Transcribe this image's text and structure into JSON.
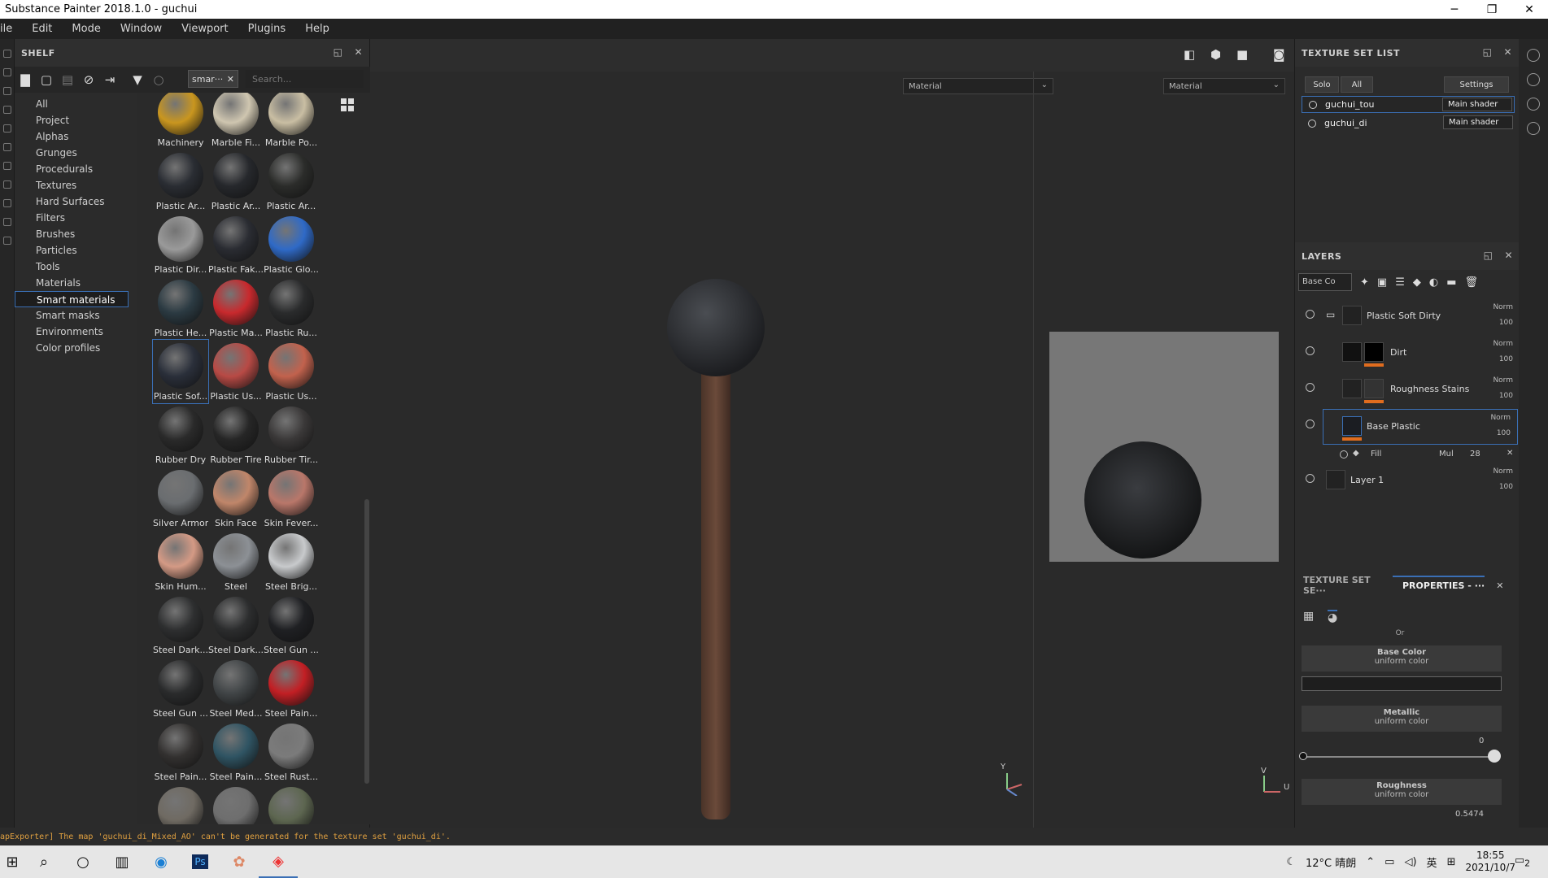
{
  "window": {
    "title": "Substance Painter 2018.1.0 - guchui",
    "min": "─",
    "max": "❐",
    "close": "✕"
  },
  "menu": [
    "ile",
    "Edit",
    "Mode",
    "Window",
    "Viewport",
    "Plugins",
    "Help"
  ],
  "shelf": {
    "title": "SHELF",
    "filter_chip": "smar···",
    "search_placeholder": "Search...",
    "categories": [
      "All",
      "Project",
      "Alphas",
      "Grunges",
      "Procedurals",
      "Textures",
      "Hard Surfaces",
      "Filters",
      "Brushes",
      "Particles",
      "Tools",
      "Materials",
      "Smart materials",
      "Smart masks",
      "Environments",
      "Color profiles"
    ],
    "selected_category": "Smart materials",
    "materials": [
      {
        "label": "Machinery",
        "color": "#c9961f"
      },
      {
        "label": "Marble Fi...",
        "color": "#cfc6b0"
      },
      {
        "label": "Marble Po...",
        "color": "#c9bea3"
      },
      {
        "label": "Plastic Ar...",
        "color": "#2a2d33"
      },
      {
        "label": "Plastic Ar...",
        "color": "#26282c"
      },
      {
        "label": "Plastic Ar...",
        "color": "#2b2c2a"
      },
      {
        "label": "Plastic Dir...",
        "color": "#9a9a9a"
      },
      {
        "label": "Plastic Fak...",
        "color": "#2a2c32"
      },
      {
        "label": "Plastic Glo...",
        "color": "#2f6ac7"
      },
      {
        "label": "Plastic He...",
        "color": "#2b3a42"
      },
      {
        "label": "Plastic Ma...",
        "color": "#c8292d"
      },
      {
        "label": "Plastic Ru...",
        "color": "#2a2b2c"
      },
      {
        "label": "Plastic Sof...",
        "color": "#2a2f3a"
      },
      {
        "label": "Plastic Us...",
        "color": "#b84a45"
      },
      {
        "label": "Plastic Us...",
        "color": "#c2624d"
      },
      {
        "label": "Rubber Dry",
        "color": "#2a2a2a"
      },
      {
        "label": "Rubber Tire",
        "color": "#262626"
      },
      {
        "label": "Rubber Tir...",
        "color": "#3a3838"
      },
      {
        "label": "Silver Armor",
        "color": "#6a6d70"
      },
      {
        "label": "Skin Face",
        "color": "#c0866a"
      },
      {
        "label": "Skin Fever...",
        "color": "#b9776a"
      },
      {
        "label": "Skin Hum...",
        "color": "#d49a85"
      },
      {
        "label": "Steel",
        "color": "#8c9095"
      },
      {
        "label": "Steel Brig...",
        "color": "#c8cacc"
      },
      {
        "label": "Steel Dark...",
        "color": "#2e2f30"
      },
      {
        "label": "Steel Dark...",
        "color": "#2c2d2e"
      },
      {
        "label": "Steel Gun ...",
        "color": "#1f2023"
      },
      {
        "label": "Steel Gun ...",
        "color": "#2a2b2c"
      },
      {
        "label": "Steel Med...",
        "color": "#414547"
      },
      {
        "label": "Steel Pain...",
        "color": "#c21f24"
      },
      {
        "label": "Steel Pain...",
        "color": "#333130"
      },
      {
        "label": "Steel Pain...",
        "color": "#2f5463"
      },
      {
        "label": "Steel Rust...",
        "color": "#7b7b7b"
      },
      {
        "label": "",
        "color": "#6f6a62"
      },
      {
        "label": "",
        "color": "#6e6e6e"
      },
      {
        "label": "",
        "color": "#5d6650"
      }
    ],
    "selected_material_index": 12
  },
  "viewport": {
    "left_mode": "Material",
    "right_mode": "Material",
    "axis_y": "Y",
    "axis_x": "X",
    "axis_z": "Z",
    "axis_v": "V",
    "axis_u": "U"
  },
  "texture_set_list": {
    "title": "TEXTURE SET LIST",
    "solo": "Solo",
    "all": "All",
    "settings": "Settings",
    "sets": [
      {
        "name": "guchui_tou",
        "shader": "Main shader"
      },
      {
        "name": "guchui_di",
        "shader": "Main shader"
      }
    ]
  },
  "layers": {
    "title": "LAYERS",
    "channel": "Base Co",
    "items": [
      {
        "name": "Plastic Soft Dirty",
        "blend": "Norm",
        "opacity": "100"
      },
      {
        "name": "Dirt",
        "blend": "Norm",
        "opacity": "100"
      },
      {
        "name": "Roughness Stains",
        "blend": "Norm",
        "opacity": "100"
      },
      {
        "name": "Base Plastic",
        "blend": "Norm",
        "opacity": "100"
      },
      {
        "name": "Layer 1",
        "blend": "Norm",
        "opacity": "100"
      }
    ],
    "fill": {
      "name": "Fill",
      "blend": "Mul",
      "opacity": "28"
    }
  },
  "properties": {
    "tab1": "TEXTURE SET SE···",
    "tab2": "PROPERTIES - ···",
    "or": "Or",
    "base_color": {
      "title": "Base Color",
      "sub": "uniform color"
    },
    "metallic": {
      "title": "Metallic",
      "sub": "uniform color",
      "value": "0"
    },
    "roughness": {
      "title": "Roughness",
      "sub": "uniform color",
      "value": "0.5474"
    }
  },
  "status": "apExporter] The map 'guchui_di_Mixed_AO' can't be generated for the texture set 'guchui_di'.",
  "taskbar": {
    "weather": "12°C 晴朗",
    "ime": "英",
    "time": "18:55",
    "date": "2021/10/7",
    "notif": "2"
  }
}
